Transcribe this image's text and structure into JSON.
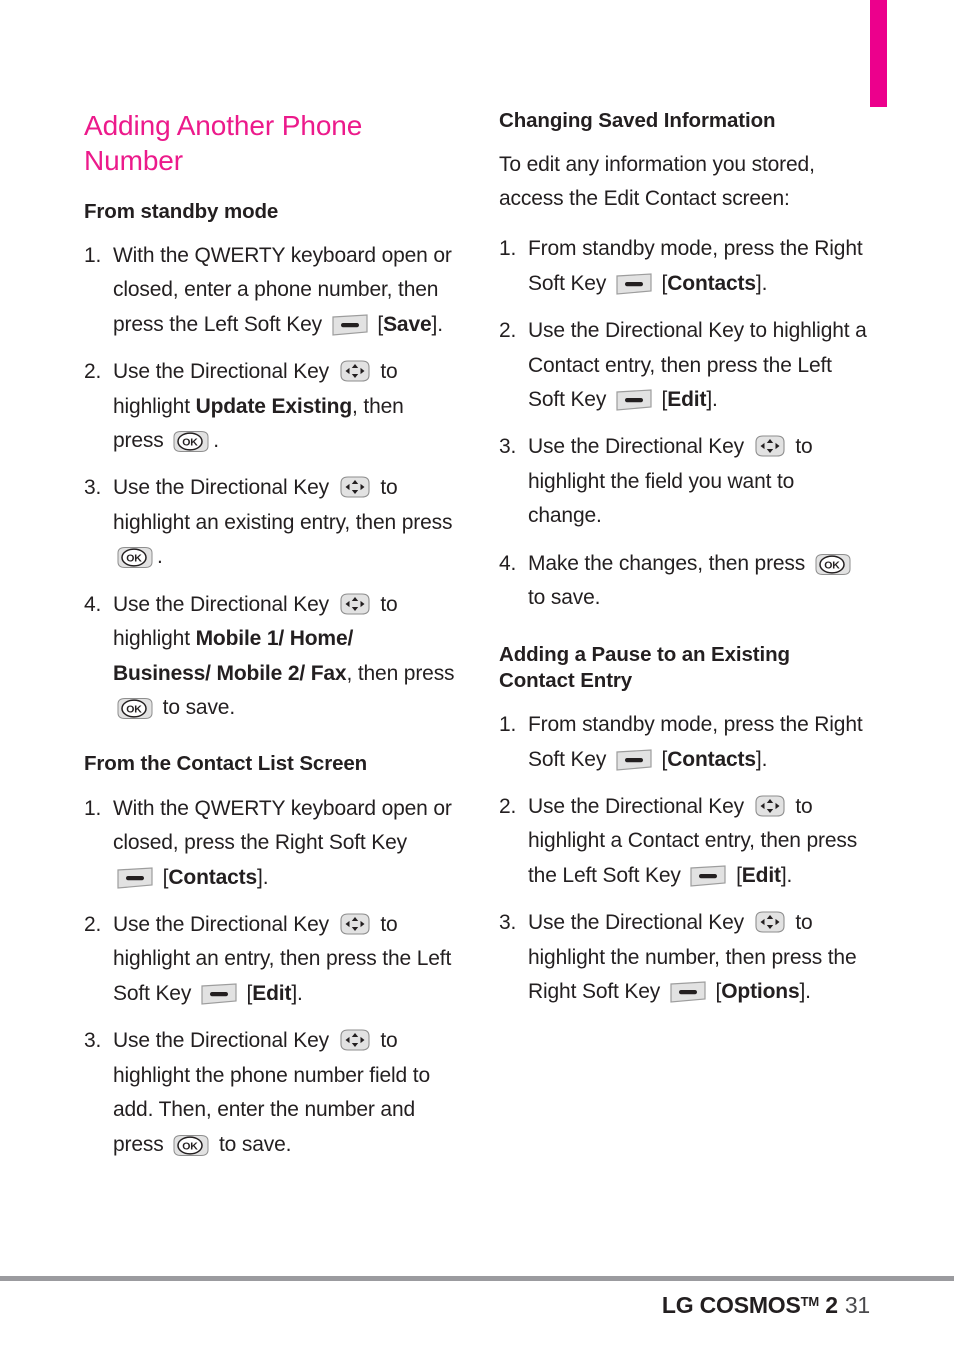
{
  "colors": {
    "accent_magenta": "#ec008c",
    "heading_pink": "#ec1a8b",
    "body_text": "#231f20",
    "footer_rule": "#9b9b9f"
  },
  "icons": {
    "soft_key": "soft-key-icon",
    "directional_key": "directional-key-icon",
    "ok_key": "ok-key-icon",
    "ok_label": "OK"
  },
  "left_column": {
    "chapter_title": "Adding Another Phone Number",
    "section_1": {
      "heading": "From standby mode",
      "steps": [
        {
          "num": "1.",
          "parts": [
            {
              "t": "text",
              "v": "With the QWERTY keyboard open or closed, enter a phone number, then press the Left Soft Key "
            },
            {
              "t": "icon",
              "v": "soft-key"
            },
            {
              "t": "text",
              "v": " ["
            },
            {
              "t": "bold",
              "v": "Save"
            },
            {
              "t": "text",
              "v": "]."
            }
          ]
        },
        {
          "num": "2.",
          "parts": [
            {
              "t": "text",
              "v": "Use the Directional Key "
            },
            {
              "t": "icon",
              "v": "directional-key"
            },
            {
              "t": "text",
              "v": " to highlight "
            },
            {
              "t": "bold",
              "v": "Update Existing"
            },
            {
              "t": "text",
              "v": ", then press "
            },
            {
              "t": "icon",
              "v": "ok-key"
            },
            {
              "t": "text",
              "v": "."
            }
          ]
        },
        {
          "num": "3.",
          "parts": [
            {
              "t": "text",
              "v": "Use the Directional Key "
            },
            {
              "t": "icon",
              "v": "directional-key"
            },
            {
              "t": "text",
              "v": " to highlight an existing entry, then press "
            },
            {
              "t": "icon",
              "v": "ok-key"
            },
            {
              "t": "text",
              "v": "."
            }
          ]
        },
        {
          "num": "4.",
          "parts": [
            {
              "t": "text",
              "v": "Use the Directional Key "
            },
            {
              "t": "icon",
              "v": "directional-key"
            },
            {
              "t": "text",
              "v": " to highlight "
            },
            {
              "t": "bold",
              "v": "Mobile 1/ Home/ Business/ Mobile 2/ Fax"
            },
            {
              "t": "text",
              "v": ", then press "
            },
            {
              "t": "icon",
              "v": "ok-key"
            },
            {
              "t": "text",
              "v": " to save."
            }
          ]
        }
      ]
    },
    "section_2": {
      "heading": "From the Contact List Screen",
      "steps": [
        {
          "num": "1.",
          "parts": [
            {
              "t": "text",
              "v": "With the QWERTY keyboard open or closed, press the Right Soft Key "
            },
            {
              "t": "icon",
              "v": "soft-key"
            },
            {
              "t": "text",
              "v": " ["
            },
            {
              "t": "bold",
              "v": "Contacts"
            },
            {
              "t": "text",
              "v": "]."
            }
          ]
        },
        {
          "num": "2.",
          "parts": [
            {
              "t": "text",
              "v": "Use the Directional Key "
            },
            {
              "t": "icon",
              "v": "directional-key"
            },
            {
              "t": "text",
              "v": " to highlight an entry, then press the Left Soft Key "
            },
            {
              "t": "icon",
              "v": "soft-key"
            },
            {
              "t": "text",
              "v": " ["
            },
            {
              "t": "bold",
              "v": "Edit"
            },
            {
              "t": "text",
              "v": "]."
            }
          ]
        },
        {
          "num": "3.",
          "parts": [
            {
              "t": "text",
              "v": "Use the Directional Key "
            },
            {
              "t": "icon",
              "v": "directional-key"
            },
            {
              "t": "text",
              "v": " to highlight the phone number field to add. Then, enter the number and press "
            },
            {
              "t": "icon",
              "v": "ok-key"
            },
            {
              "t": "text",
              "v": " to save."
            }
          ]
        }
      ]
    }
  },
  "right_column": {
    "section_1": {
      "heading": "Changing Saved Information",
      "intro": "To edit any information you stored, access the Edit Contact screen:",
      "steps": [
        {
          "num": "1.",
          "parts": [
            {
              "t": "text",
              "v": "From standby mode, press the Right Soft Key "
            },
            {
              "t": "icon",
              "v": "soft-key"
            },
            {
              "t": "text",
              "v": " ["
            },
            {
              "t": "bold",
              "v": "Contacts"
            },
            {
              "t": "text",
              "v": "]."
            }
          ]
        },
        {
          "num": "2.",
          "parts": [
            {
              "t": "text",
              "v": "Use the Directional Key  to highlight a Contact entry, then press the Left Soft Key "
            },
            {
              "t": "icon",
              "v": "soft-key"
            },
            {
              "t": "text",
              "v": " ["
            },
            {
              "t": "bold",
              "v": "Edit"
            },
            {
              "t": "text",
              "v": "]."
            }
          ]
        },
        {
          "num": "3.",
          "parts": [
            {
              "t": "text",
              "v": "Use the Directional Key "
            },
            {
              "t": "icon",
              "v": "directional-key"
            },
            {
              "t": "text",
              "v": " to highlight the field you want to change."
            }
          ]
        },
        {
          "num": "4.",
          "parts": [
            {
              "t": "text",
              "v": "Make the changes, then press "
            },
            {
              "t": "icon",
              "v": "ok-key"
            },
            {
              "t": "text",
              "v": " to save."
            }
          ]
        }
      ]
    },
    "section_2": {
      "heading": "Adding a Pause to an Existing Contact Entry",
      "steps": [
        {
          "num": "1.",
          "parts": [
            {
              "t": "text",
              "v": "From standby mode, press the Right Soft Key "
            },
            {
              "t": "icon",
              "v": "soft-key"
            },
            {
              "t": "text",
              "v": " ["
            },
            {
              "t": "bold",
              "v": "Contacts"
            },
            {
              "t": "text",
              "v": "]."
            }
          ]
        },
        {
          "num": "2.",
          "parts": [
            {
              "t": "text",
              "v": "Use the Directional Key "
            },
            {
              "t": "icon",
              "v": "directional-key"
            },
            {
              "t": "text",
              "v": " to highlight a Contact entry, then press the Left Soft Key "
            },
            {
              "t": "icon",
              "v": "soft-key"
            },
            {
              "t": "text",
              "v": " ["
            },
            {
              "t": "bold",
              "v": "Edit"
            },
            {
              "t": "text",
              "v": "]."
            }
          ]
        },
        {
          "num": "3.",
          "parts": [
            {
              "t": "text",
              "v": "Use the Directional Key "
            },
            {
              "t": "icon",
              "v": "directional-key"
            },
            {
              "t": "text",
              "v": " to highlight the number, then press the Right Soft Key "
            },
            {
              "t": "icon",
              "v": "soft-key"
            },
            {
              "t": "text",
              "v": " ["
            },
            {
              "t": "bold",
              "v": "Options"
            },
            {
              "t": "text",
              "v": "]."
            }
          ]
        }
      ]
    }
  },
  "footer": {
    "brand": "LG COSMOS",
    "trademark": "TM",
    "model": "2",
    "page_number": "31"
  }
}
